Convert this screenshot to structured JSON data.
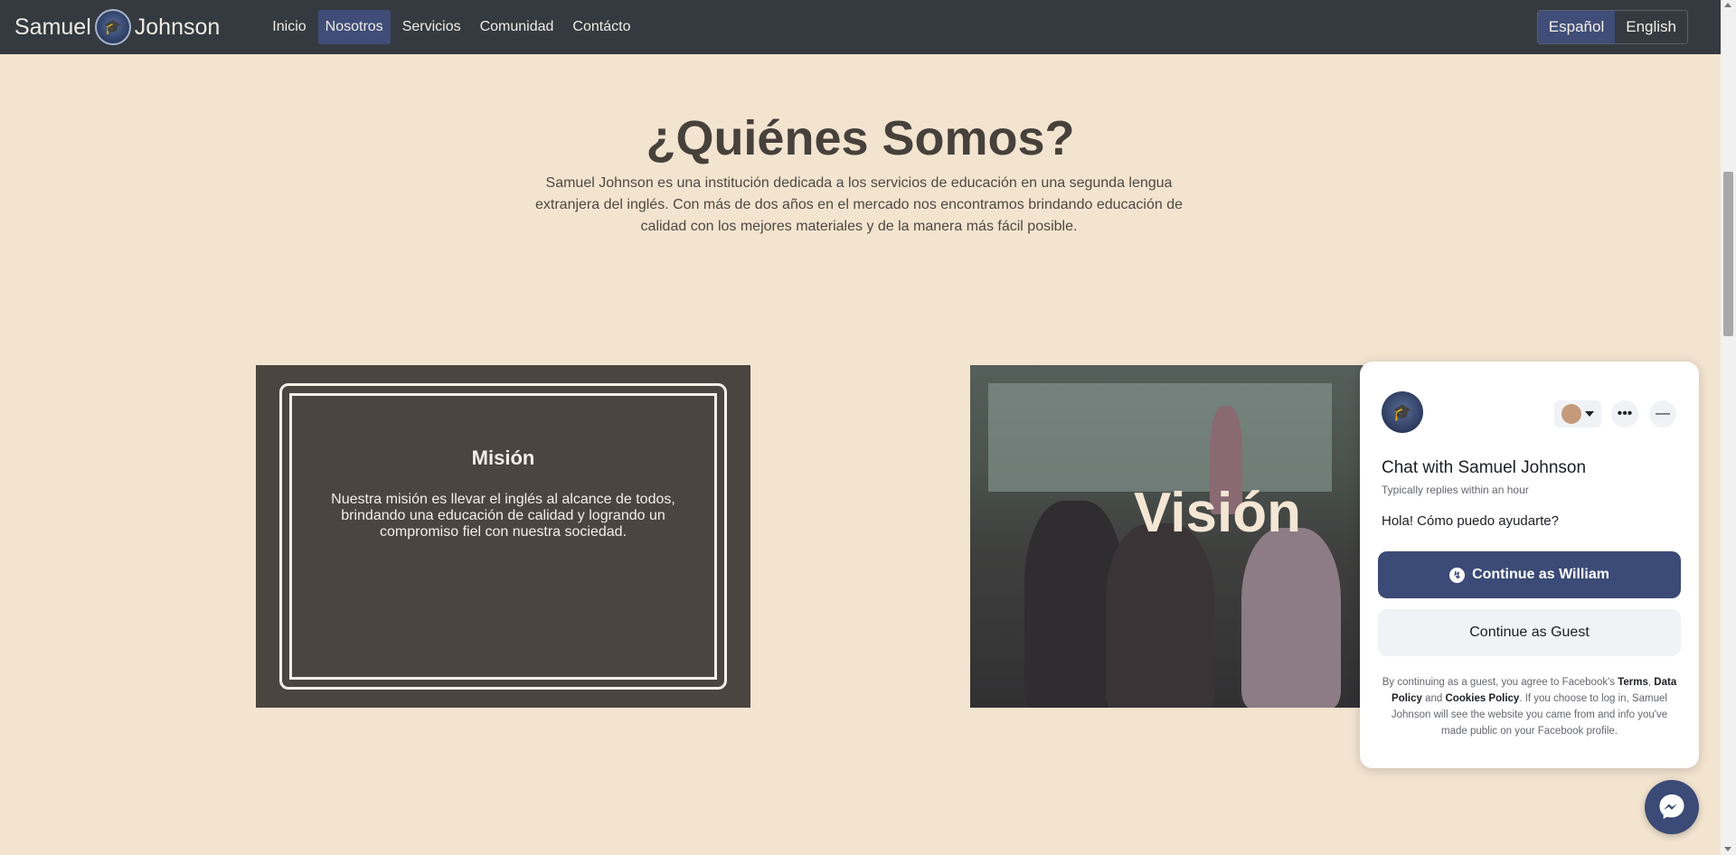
{
  "navbar": {
    "brand_left": "Samuel",
    "brand_right": "Johnson",
    "items": [
      {
        "label": "Inicio"
      },
      {
        "label": "Nosotros"
      },
      {
        "label": "Servicios"
      },
      {
        "label": "Comunidad"
      },
      {
        "label": "Contácto"
      }
    ],
    "active_item": "Nosotros",
    "languages": [
      "Español",
      "English"
    ],
    "active_language": "Español"
  },
  "about": {
    "title": "¿Quiénes Somos?",
    "text": "Samuel Johnson es una institución dedicada a los servicios de educación en una segunda lengua extranjera del inglés. Con más de dos años en el mercado nos encontramos brindando educación de calidad con los mejores materiales y de la manera más fácil posible."
  },
  "mision": {
    "title": "Misión",
    "text": "Nuestra misión es llevar el inglés al alcance de todos, brindando una educación de calidad y logrando un compromiso fiel con nuestra sociedad."
  },
  "vision": {
    "title": "Visión"
  },
  "chat": {
    "title": "Chat with Samuel Johnson",
    "subtitle": "Typically replies within an hour",
    "message": "Hola! Cómo puedo ayudarte?",
    "primary_button": "Continue as William",
    "secondary_button": "Continue as Guest",
    "legal_1": "By continuing as a guest, you agree to Facebook's ",
    "legal_terms": "Terms",
    "legal_2": ", ",
    "legal_data_policy": "Data Policy",
    "legal_3": " and ",
    "legal_cookies": "Cookies Policy",
    "legal_4": ". If you choose to log in, Samuel Johnson will see the website you came from and info you've made public on your Facebook profile."
  },
  "colors": {
    "navbar": "#343a40",
    "accent": "#3f4d78",
    "page_bg": "#f3e4d0",
    "card_dark": "#4a453f"
  }
}
